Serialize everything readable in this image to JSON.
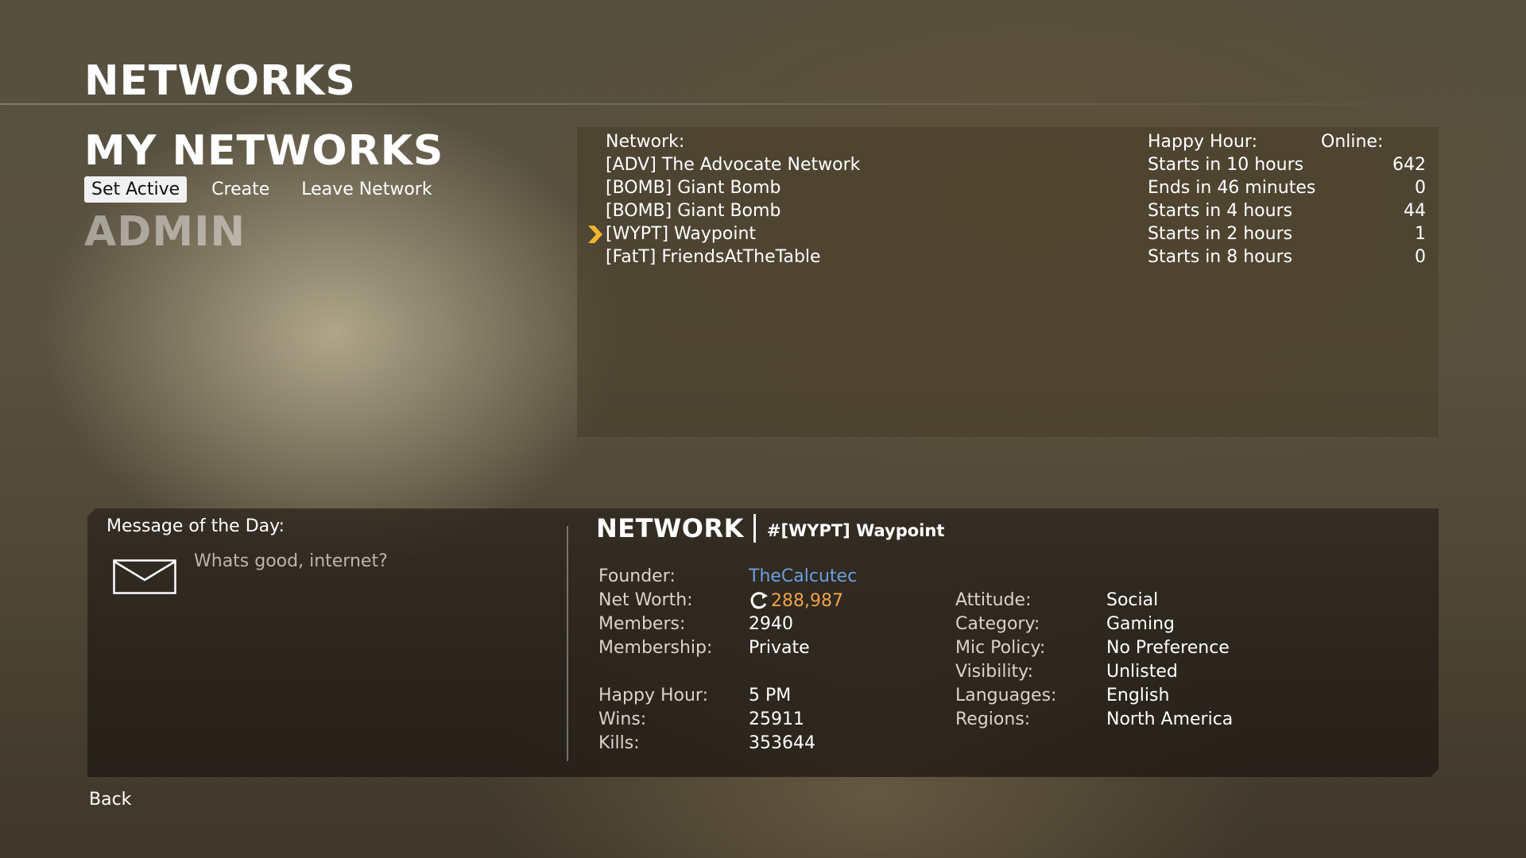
{
  "header": {
    "title": "NETWORKS"
  },
  "my_networks": {
    "title": "MY NETWORKS",
    "actions": [
      {
        "label": "Set Active",
        "active": true
      },
      {
        "label": "Create",
        "active": false
      },
      {
        "label": "Leave Network",
        "active": false
      }
    ],
    "role": "ADMIN"
  },
  "network_list": {
    "columns": {
      "network": "Network:",
      "happy_hour": "Happy Hour:",
      "online": "Online:"
    },
    "rows": [
      {
        "name": "[ADV] The Advocate Network",
        "happy_hour": "Starts in 10 hours",
        "online": "642",
        "selected": false
      },
      {
        "name": "[BOMB] Giant Bomb",
        "happy_hour": "Ends in 46 minutes",
        "online": "0",
        "selected": false
      },
      {
        "name": "[BOMB] Giant Bomb",
        "happy_hour": "Starts in 4 hours",
        "online": "44",
        "selected": false
      },
      {
        "name": "[WYPT] Waypoint",
        "happy_hour": "Starts in 2 hours",
        "online": "1",
        "selected": true
      },
      {
        "name": "[FatT] FriendsAtTheTable",
        "happy_hour": "Starts in 8 hours",
        "online": "0",
        "selected": false
      }
    ],
    "selection_icon": "chevron-right-icon",
    "selection_color": "#f2b431"
  },
  "motd": {
    "label": "Message of the Day:",
    "icon": "envelope-icon",
    "text": "Whats good, internet?"
  },
  "details": {
    "title": "NETWORK",
    "tag": "#[WYPT] Waypoint",
    "left": [
      {
        "label": "Founder:",
        "value": "TheCalcutec"
      },
      {
        "label": "Net Worth:",
        "value": "288,987"
      },
      {
        "label": "Members:",
        "value": "2940"
      },
      {
        "label": "Membership:",
        "value": "Private"
      },
      {
        "label": "Happy Hour:",
        "value": "5 PM"
      },
      {
        "label": "Wins:",
        "value": "25911"
      },
      {
        "label": "Kills:",
        "value": "353644"
      }
    ],
    "right": [
      {
        "label": "Attitude:",
        "value": "Social"
      },
      {
        "label": "Category:",
        "value": "Gaming"
      },
      {
        "label": "Mic Policy:",
        "value": "No Preference"
      },
      {
        "label": "Visibility:",
        "value": "Unlisted"
      },
      {
        "label": "Languages:",
        "value": "English"
      },
      {
        "label": "Regions:",
        "value": "North America"
      }
    ],
    "colors": {
      "founder_link": "#6c9ee0",
      "net_worth": "#f0a24a"
    },
    "net_worth_icon": "credits-icon"
  },
  "footer": {
    "back_label": "Back"
  }
}
